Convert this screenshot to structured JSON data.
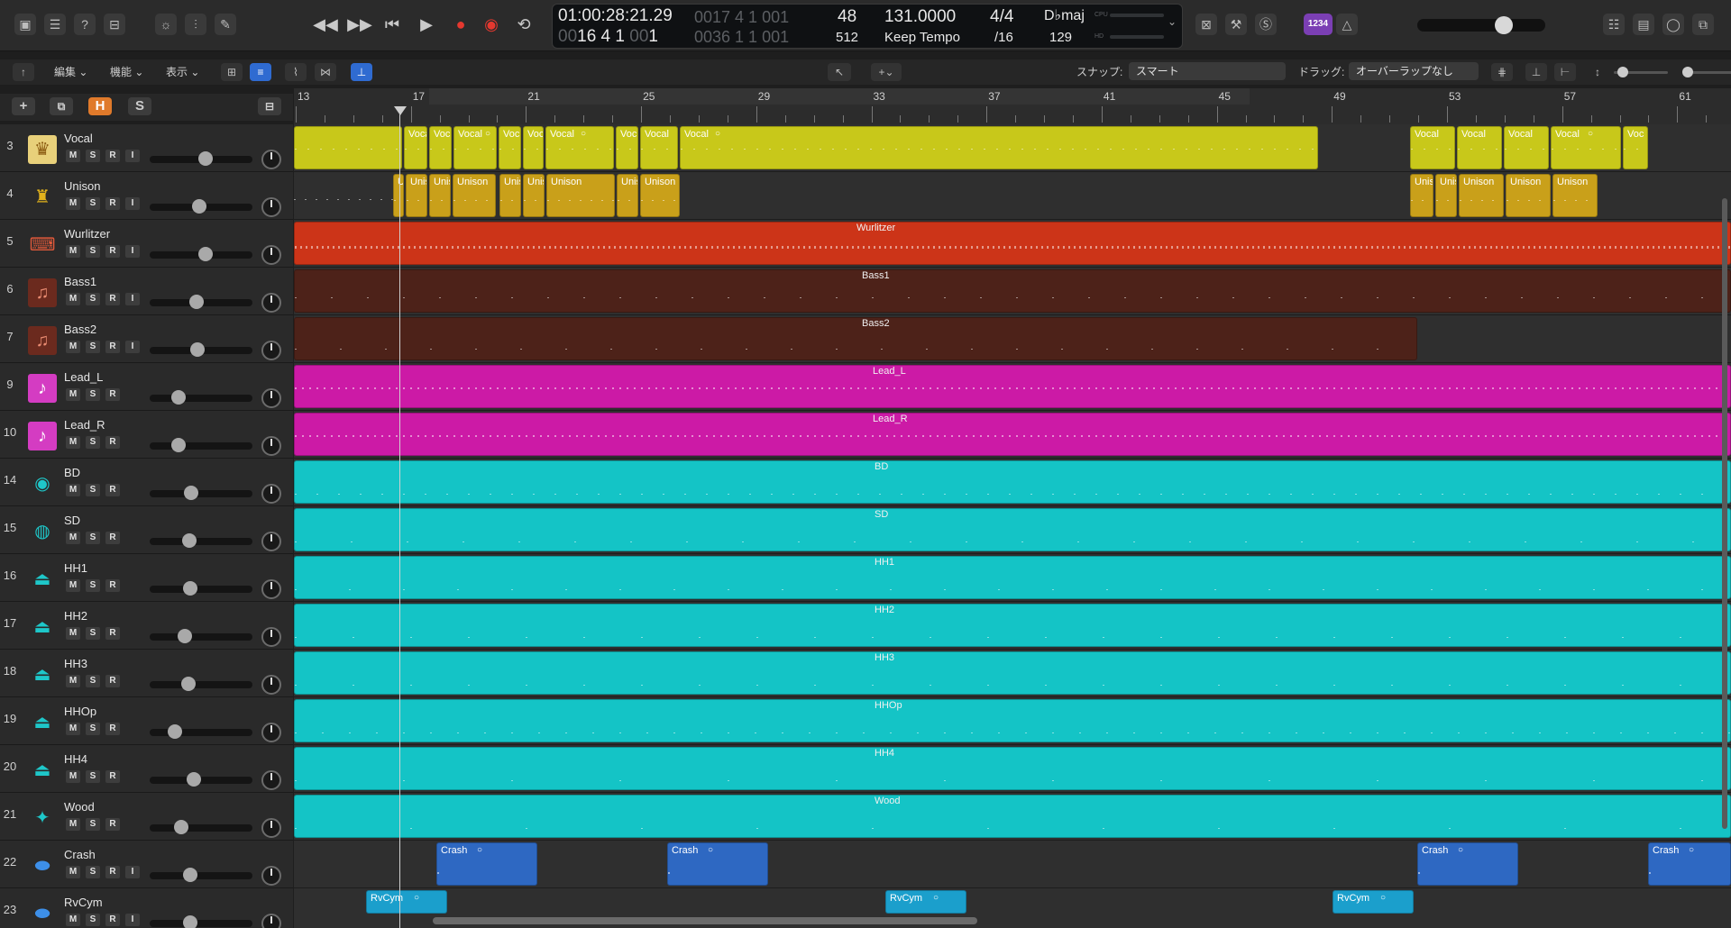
{
  "control_bar": {
    "position_time": "01:00:28:21.29",
    "position_bars": "16  4  1",
    "position_bars_sub": "1",
    "position_bars_dim1": "00",
    "position_bars_dim2": "00",
    "end_dim_top": "0017 4 1 001",
    "end_dim_bottom": "0036 1 1 001",
    "cycle_top": "48",
    "cycle_bottom": "512",
    "tempo": "131.0000",
    "tempo_mode": "Keep Tempo",
    "signature": "4/4",
    "division": "/16",
    "key": "D♭maj",
    "key_value": "129",
    "cpu_label": "CPU",
    "hd_label": "HD",
    "count_in": "1234"
  },
  "toolbar": {
    "edit_menu": "編集",
    "function_menu": "機能",
    "view_menu": "表示",
    "snap_label": "スナップ:",
    "snap_value": "スマート",
    "drag_label": "ドラッグ:",
    "drag_value": "オーバーラップなし"
  },
  "track_header": {
    "add_label": "+",
    "h_label": "H",
    "s_label": "S"
  },
  "ruler": {
    "bars": [
      "13",
      "17",
      "21",
      "25",
      "29",
      "33",
      "37",
      "41",
      "45",
      "49",
      "53",
      "57",
      "61"
    ]
  },
  "tracks": [
    {
      "number": "3",
      "name": "Vocal",
      "color": "#c8c81a",
      "icon": "singer-icon",
      "buttons": [
        "M",
        "S",
        "R",
        "I"
      ],
      "volume": 0.55
    },
    {
      "number": "4",
      "name": "Unison",
      "color": "#d2a41a",
      "icon": "choir-icon",
      "buttons": [
        "M",
        "S",
        "R",
        "I"
      ],
      "volume": 0.48
    },
    {
      "number": "5",
      "name": "Wurlitzer",
      "color": "#cc3418",
      "icon": "keyboard-icon",
      "buttons": [
        "M",
        "S",
        "R",
        "I"
      ],
      "volume": 0.55
    },
    {
      "number": "6",
      "name": "Bass1",
      "color": "#4d2219",
      "icon": "bass-icon",
      "buttons": [
        "M",
        "S",
        "R",
        "I"
      ],
      "volume": 0.45
    },
    {
      "number": "7",
      "name": "Bass2",
      "color": "#4d2219",
      "icon": "bass-icon",
      "buttons": [
        "M",
        "S",
        "R",
        "I"
      ],
      "volume": 0.46
    },
    {
      "number": "9",
      "name": "Lead_L",
      "color": "#cc1aa6",
      "icon": "synth-icon",
      "buttons": [
        "M",
        "S",
        "R"
      ],
      "volume": 0.24
    },
    {
      "number": "10",
      "name": "Lead_R",
      "color": "#cc1aa6",
      "icon": "synth-icon",
      "buttons": [
        "M",
        "S",
        "R"
      ],
      "volume": 0.24
    },
    {
      "number": "14",
      "name": "BD",
      "color": "#14c4c6",
      "icon": "kick-drum-icon",
      "buttons": [
        "M",
        "S",
        "R"
      ],
      "volume": 0.39
    },
    {
      "number": "15",
      "name": "SD",
      "color": "#14c4c6",
      "icon": "snare-drum-icon",
      "buttons": [
        "M",
        "S",
        "R"
      ],
      "volume": 0.37
    },
    {
      "number": "16",
      "name": "HH1",
      "color": "#14c4c6",
      "icon": "hihat-icon",
      "buttons": [
        "M",
        "S",
        "R"
      ],
      "volume": 0.38
    },
    {
      "number": "17",
      "name": "HH2",
      "color": "#14c4c6",
      "icon": "hihat-icon",
      "buttons": [
        "M",
        "S",
        "R"
      ],
      "volume": 0.32
    },
    {
      "number": "18",
      "name": "HH3",
      "color": "#14c4c6",
      "icon": "hihat-icon",
      "buttons": [
        "M",
        "S",
        "R"
      ],
      "volume": 0.36
    },
    {
      "number": "19",
      "name": "HHOp",
      "color": "#14c4c6",
      "icon": "hihat-icon",
      "buttons": [
        "M",
        "S",
        "R"
      ],
      "volume": 0.2
    },
    {
      "number": "20",
      "name": "HH4",
      "color": "#14c4c6",
      "icon": "hihat-icon",
      "buttons": [
        "M",
        "S",
        "R"
      ],
      "volume": 0.42
    },
    {
      "number": "21",
      "name": "Wood",
      "color": "#14c4c6",
      "icon": "woodblock-icon",
      "buttons": [
        "M",
        "S",
        "R"
      ],
      "volume": 0.28
    },
    {
      "number": "22",
      "name": "Crash",
      "color": "#2e68c2",
      "icon": "cymbal-icon",
      "buttons": [
        "M",
        "S",
        "R",
        "I"
      ],
      "volume": 0.38
    },
    {
      "number": "23",
      "name": "RvCym",
      "color": "#1b9fcc",
      "icon": "cymbal-icon",
      "buttons": [
        "M",
        "S",
        "R",
        "I"
      ],
      "volume": 0.38
    }
  ],
  "regions": {
    "vocal_short": "Voc",
    "vocal_mid": "Voca",
    "vocal": "Vocal",
    "unison_u": "U",
    "unison_short": "Unis",
    "unison": "Unison",
    "wurlitzer": "Wurlitzer",
    "bass1": "Bass1",
    "bass2": "Bass2",
    "lead_l": "Lead_L",
    "lead_r": "Lead_R",
    "bd": "BD",
    "sd": "SD",
    "hh1": "HH1",
    "hh2": "HH2",
    "hh3": "HH3",
    "hhop": "HHOp",
    "hh4": "HH4",
    "wood": "Wood",
    "crash": "Crash",
    "rvcym": "RvCym"
  }
}
